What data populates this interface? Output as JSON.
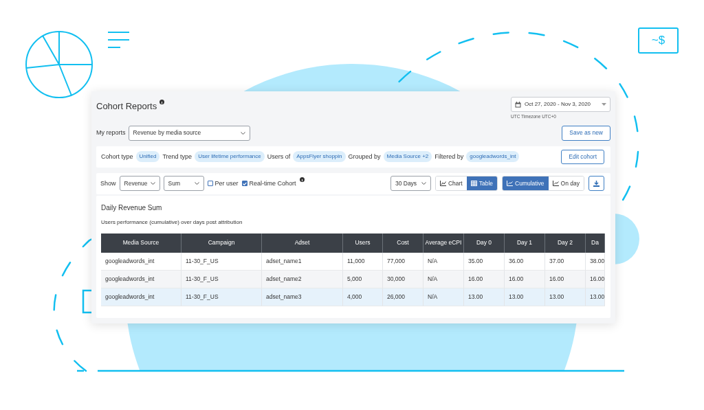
{
  "decoration": {
    "money_label": "~$"
  },
  "header": {
    "title": "Cohort Reports",
    "date_range": "Oct 27, 2020 - Nov 3, 2020",
    "timezone": "UTC Timezone UTC+0"
  },
  "my_reports": {
    "label": "My reports",
    "value": "Revenue by media source",
    "save_button": "Save as new"
  },
  "cohort_filters": [
    {
      "label": "Cohort type",
      "value": "Unified"
    },
    {
      "label": "Trend type",
      "value": "User lifetime performance"
    },
    {
      "label": "Users of",
      "value": "AppsFlyer shoppin"
    },
    {
      "label": "Grouped by",
      "value": "Media Source +2"
    },
    {
      "label": "Filtered by",
      "value": "googleadwords_int"
    }
  ],
  "edit_button": "Edit cohort",
  "toolbar": {
    "show_label": "Show",
    "metric": "Revenue",
    "aggregation": "Sum",
    "options": [
      {
        "label": "Per user",
        "checked": false
      },
      {
        "label": "Real-time Cohort",
        "checked": true
      }
    ],
    "range": "30 Days",
    "view_toggle": [
      {
        "label": "Chart",
        "kind": "chart",
        "selected": false
      },
      {
        "label": "Table",
        "kind": "table",
        "selected": true
      }
    ],
    "mode_toggle": [
      {
        "label": "Cumulative",
        "kind": "line",
        "selected": true
      },
      {
        "label": "On day",
        "kind": "line",
        "selected": false
      }
    ]
  },
  "report": {
    "title": "Daily Revenue Sum",
    "subtitle": "Users performance (cumulative) over days post attribution",
    "columns": [
      "Media Source",
      "Campaign",
      "Adset",
      "Users",
      "Cost",
      "Average eCPI",
      "Day 0",
      "Day 1",
      "Day 2",
      "Da"
    ],
    "rows": [
      {
        "selected": false,
        "cells": [
          "googleadwords_int",
          "11-30_F_US",
          "adset_name1",
          "11,000",
          "77,000",
          "N/A",
          "35.00",
          "36.00",
          "37.00",
          "38.00"
        ]
      },
      {
        "selected": false,
        "cells": [
          "googleadwords_int",
          "11-30_F_US",
          "adset_name2",
          "5,000",
          "30,000",
          "N/A",
          "16.00",
          "16.00",
          "16.00",
          "16.00"
        ]
      },
      {
        "selected": true,
        "cells": [
          "googleadwords_int",
          "11-30_F_US",
          "adset_name3",
          "4,000",
          "26,000",
          "N/A",
          "13.00",
          "13.00",
          "13.00",
          "13.00"
        ]
      }
    ]
  }
}
